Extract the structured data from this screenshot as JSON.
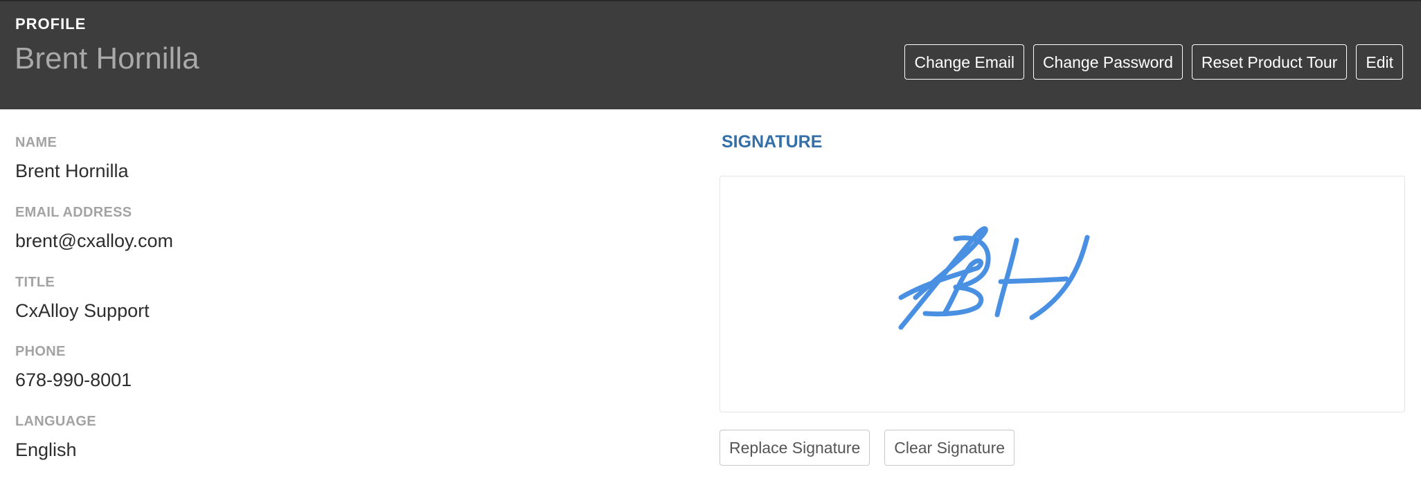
{
  "header": {
    "section_label": "PROFILE",
    "title": "Brent Hornilla",
    "actions": {
      "change_email": "Change Email",
      "change_password": "Change Password",
      "reset_product_tour": "Reset Product Tour",
      "edit": "Edit"
    }
  },
  "profile": {
    "name": {
      "label": "NAME",
      "value": "Brent Hornilla"
    },
    "email": {
      "label": "EMAIL ADDRESS",
      "value": "brent@cxalloy.com"
    },
    "title": {
      "label": "TITLE",
      "value": "CxAlloy Support"
    },
    "phone": {
      "label": "PHONE",
      "value": "678-990-8001"
    },
    "language": {
      "label": "LANGUAGE",
      "value": "English"
    }
  },
  "signature": {
    "heading": "SIGNATURE",
    "ink_text": "BH",
    "ink_color": "#4a90e2",
    "replace_label": "Replace Signature",
    "clear_label": "Clear Signature"
  },
  "colors": {
    "header_bg": "#3d3d3d",
    "accent": "#346fa8",
    "label": "#a3a3a3"
  }
}
